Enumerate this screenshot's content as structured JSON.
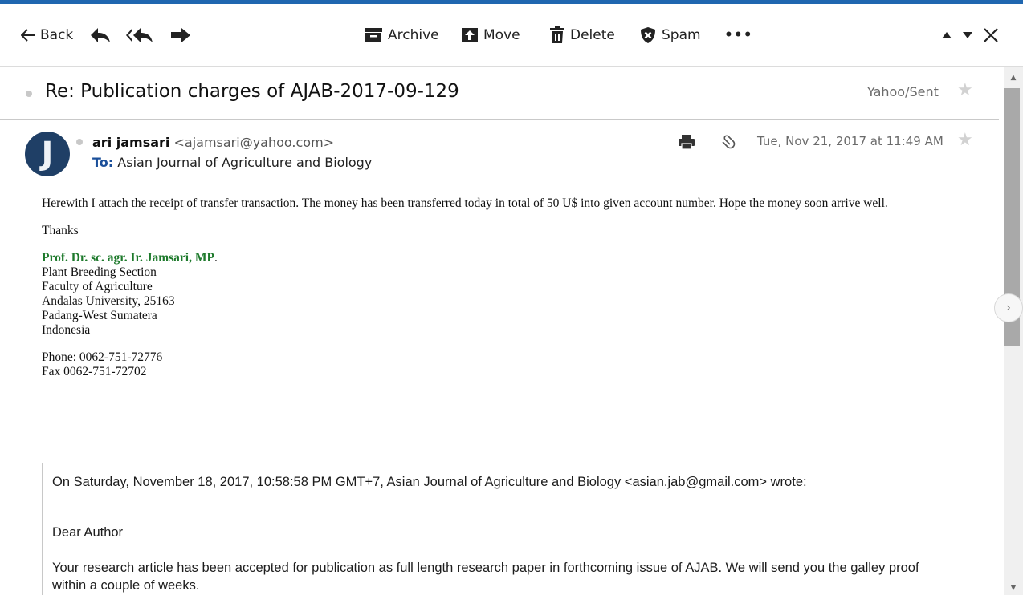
{
  "toolbar": {
    "back_label": "Back",
    "archive_label": "Archive",
    "move_label": "Move",
    "delete_label": "Delete",
    "spam_label": "Spam",
    "more_label": "•••"
  },
  "message": {
    "subject": "Re: Publication charges of AJAB-2017-09-129",
    "folder": "Yahoo/Sent",
    "avatar_initial": "J",
    "sender_name": "ari jamsari",
    "sender_email": "<ajamsari@yahoo.com>",
    "to_label": "To:",
    "recipient": "Asian Journal of Agriculture and Biology",
    "date": "Tue, Nov 21, 2017 at 11:49 AM"
  },
  "body": {
    "paragraph": "Herewith I attach the receipt of transfer transaction.  The money has been transferred today in total of 50 U$ into given account number. Hope the money soon arrive well.",
    "thanks": "Thanks",
    "signature": {
      "name": "Prof. Dr. sc. agr. Ir. Jamsari, MP",
      "name_suffix": ".",
      "lines": [
        "Plant Breeding Section",
        "Faculty of Agriculture",
        "Andalas University, 25163",
        "Padang-West Sumatera",
        "Indonesia"
      ],
      "phone": "Phone: 0062-751-72776",
      "fax": "Fax 0062-751-72702"
    }
  },
  "quote": {
    "header": "On Saturday, November 18, 2017, 10:58:58 PM GMT+7, Asian Journal of Agriculture and Biology <asian.jab@gmail.com> wrote:",
    "greeting": "Dear Author",
    "text": "Your research article has been accepted for publication as full length research paper in forthcoming issue of AJAB. We will send you the galley proof within a couple of weeks."
  },
  "icons": {
    "back": "back-arrow-icon",
    "reply": "reply-icon",
    "reply_all": "reply-all-icon",
    "forward": "forward-icon",
    "archive": "archive-icon",
    "move": "move-icon",
    "delete": "trash-icon",
    "spam": "spam-shield-icon",
    "prev": "caret-up-icon",
    "next": "caret-down-icon",
    "close": "close-icon",
    "print": "printer-icon",
    "attachment": "paperclip-icon",
    "star": "star-icon"
  },
  "colors": {
    "accent": "#2067b0",
    "signature_green": "#1e7a2c",
    "avatar_bg": "#1f3f66",
    "to_label": "#1b4f9a"
  }
}
